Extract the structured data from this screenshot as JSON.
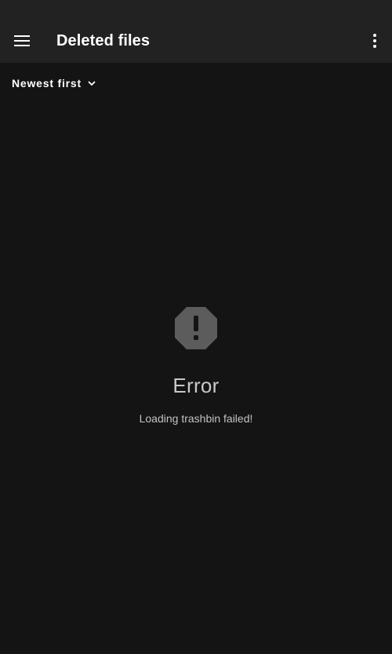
{
  "app": {
    "title": "Deleted files"
  },
  "toolbar": {
    "menu_icon": "hamburger-menu-icon",
    "overflow_icon": "more-vert-icon"
  },
  "sort": {
    "label": "Newest first",
    "icon": "chevron-down-icon"
  },
  "empty_state": {
    "icon": "error-octagon-icon",
    "title": "Error",
    "message": "Loading trashbin failed!"
  },
  "colors": {
    "background": "#141414",
    "toolbar": "#222222",
    "text_primary": "#ffffff",
    "text_secondary": "#c3c3c3",
    "icon_muted": "#5c5c5c"
  }
}
